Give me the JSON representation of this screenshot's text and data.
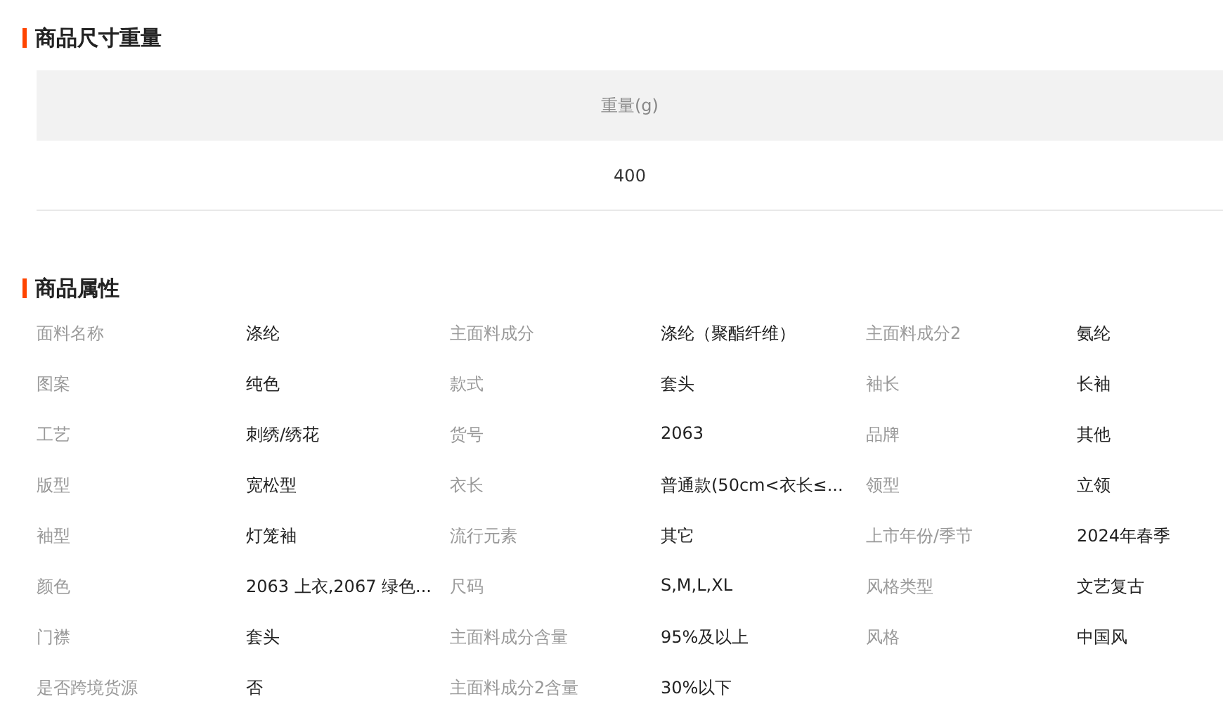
{
  "size_section": {
    "title": "商品尺寸重量",
    "columns": [
      "重量(g)"
    ],
    "rows": [
      [
        "400"
      ]
    ]
  },
  "attributes_section": {
    "title": "商品属性",
    "items": [
      {
        "label": "面料名称",
        "value": "涤纶"
      },
      {
        "label": "主面料成分",
        "value": "涤纶（聚酯纤维）"
      },
      {
        "label": "主面料成分2",
        "value": "氨纶"
      },
      {
        "label": "图案",
        "value": "纯色"
      },
      {
        "label": "款式",
        "value": "套头"
      },
      {
        "label": "袖长",
        "value": "长袖"
      },
      {
        "label": "工艺",
        "value": "刺绣/绣花"
      },
      {
        "label": "货号",
        "value": "2063"
      },
      {
        "label": "品牌",
        "value": "其他"
      },
      {
        "label": "版型",
        "value": "宽松型"
      },
      {
        "label": "衣长",
        "value": "普通款(50cm<衣长≤..."
      },
      {
        "label": "领型",
        "value": "立领"
      },
      {
        "label": "袖型",
        "value": "灯笼袖"
      },
      {
        "label": "流行元素",
        "value": "其它"
      },
      {
        "label": "上市年份/季节",
        "value": "2024年春季"
      },
      {
        "label": "颜色",
        "value": "2063 上衣,2067 绿色..."
      },
      {
        "label": "尺码",
        "value": "S,M,L,XL"
      },
      {
        "label": "风格类型",
        "value": "文艺复古"
      },
      {
        "label": "门襟",
        "value": "套头"
      },
      {
        "label": "主面料成分含量",
        "value": "95%及以上"
      },
      {
        "label": "风格",
        "value": "中国风"
      },
      {
        "label": "是否跨境货源",
        "value": "否"
      },
      {
        "label": "主面料成分2含量",
        "value": "30%以下"
      }
    ]
  }
}
